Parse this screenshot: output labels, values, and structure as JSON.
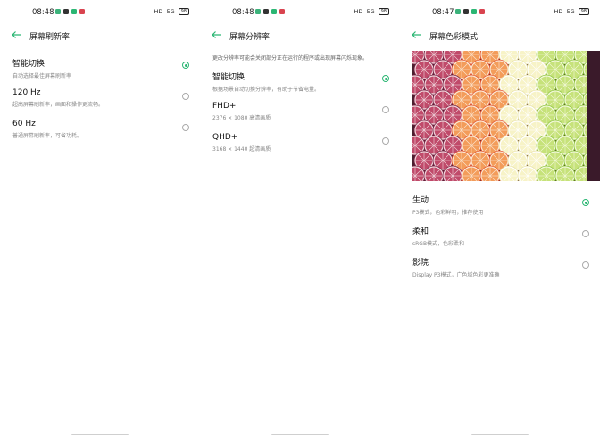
{
  "colors": {
    "accent": "#2bb673"
  },
  "panels": [
    {
      "time": "08:48",
      "status_right": {
        "hd": "HD",
        "signal": "5G",
        "battery": "98"
      },
      "title": "屏幕刷新率",
      "description": "",
      "items": [
        {
          "name": "智能切换",
          "sub": "自动选择最佳屏幕刷新率",
          "selected": true
        },
        {
          "name": "120 Hz",
          "sub": "超高屏幕刷新率，画面和操作更流畅。",
          "selected": false
        },
        {
          "name": "60 Hz",
          "sub": "普通屏幕刷新率，可省功耗。",
          "selected": false
        }
      ]
    },
    {
      "time": "08:48",
      "status_right": {
        "hd": "HD",
        "signal": "5G",
        "battery": "98"
      },
      "title": "屏幕分辨率",
      "description": "更改分辨率可能会关闭部分正在运行的程序或出现屏幕闪烁现象。",
      "items": [
        {
          "name": "智能切换",
          "sub": "根据场景自动切换分辨率，有助于节省电量。",
          "selected": true
        },
        {
          "name": "FHD+",
          "sub": "2376 × 1080 高清画质",
          "selected": false
        },
        {
          "name": "QHD+",
          "sub": "3168 × 1440 超清画质",
          "selected": false
        }
      ]
    },
    {
      "time": "08:47",
      "status_right": {
        "hd": "HD",
        "signal": "5G",
        "battery": "98"
      },
      "title": "屏幕色彩模式",
      "description": "",
      "items": [
        {
          "name": "生动",
          "sub": "P3模式，色彩鲜明，推荐使用",
          "selected": true
        },
        {
          "name": "柔和",
          "sub": "sRGB模式，色彩柔和",
          "selected": false
        },
        {
          "name": "影院",
          "sub": "Display P3模式，广色域色彩更准确",
          "selected": false
        }
      ]
    }
  ]
}
